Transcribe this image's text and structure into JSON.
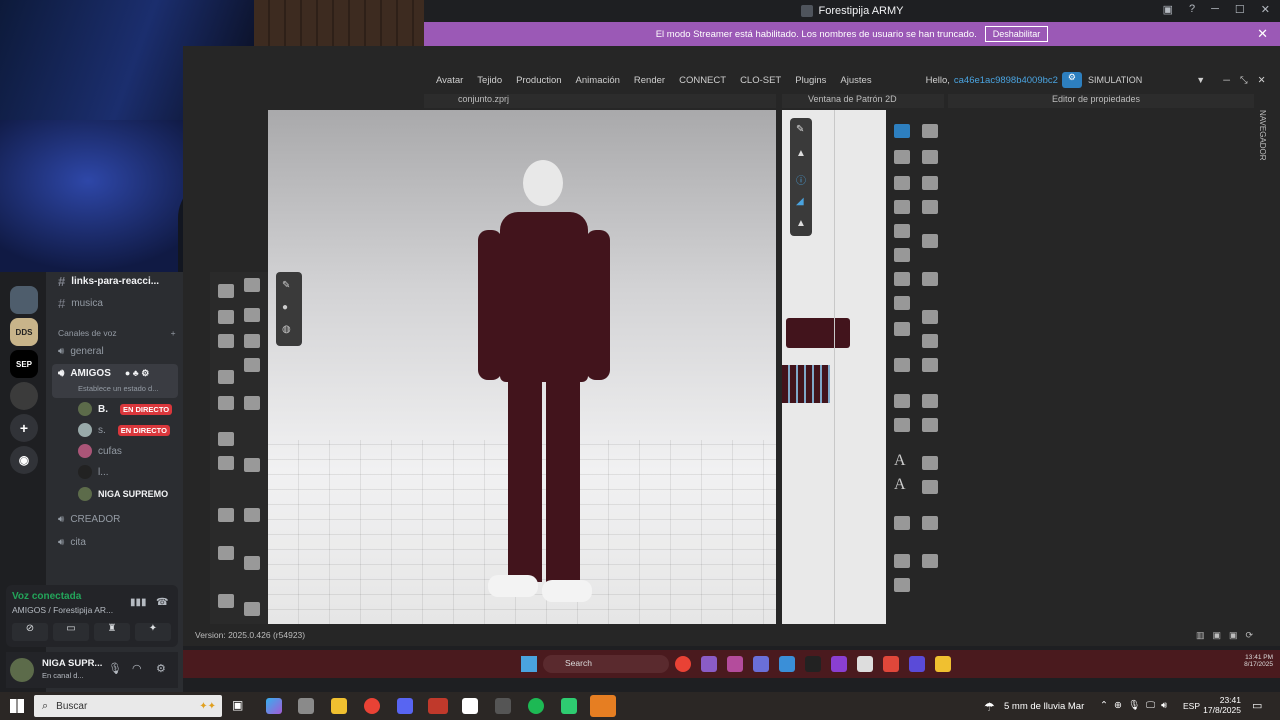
{
  "discord": {
    "title": "Forestipija ARMY",
    "streamer_notice": "El modo Streamer está habilitado. Los nombres de usuario se han truncado.",
    "streamer_disable": "Deshabilitar",
    "servers": [
      "SEP",
      "DDS"
    ],
    "channels": {
      "text": [
        "links-para-reacci...",
        "musica"
      ],
      "voice_header": "Canales de voz",
      "voice": [
        {
          "name": "general"
        },
        {
          "name": "AMIGOS",
          "status": "Establece un estado d..."
        },
        {
          "name": "CREADOR"
        },
        {
          "name": "cita"
        }
      ],
      "members": [
        {
          "name": "B.",
          "live": "EN DIRECTO"
        },
        {
          "name": "s.",
          "live": "EN DIRECTO"
        },
        {
          "name": "cufas"
        },
        {
          "name": "l..."
        },
        {
          "name": "NIGA SUPREMO"
        }
      ]
    },
    "voice_connected": "Voz conectada",
    "voice_channel": "AMIGOS / Forestipija AR...",
    "user": {
      "name": "NIGA SUPR...",
      "status": "En canal d..."
    }
  },
  "clo": {
    "menu": [
      "Avatar",
      "Tejido",
      "Production",
      "Animación",
      "Render",
      "CONNECT",
      "CLO-SET",
      "Plugins",
      "Ajustes"
    ],
    "hello": "Hello,",
    "user_id": "ca46e1ac9898b4009bc2",
    "mode": "SIMULATION",
    "file": "conjunto.zprj",
    "pattern_window": "Ventana de Patrón 2D",
    "properties": "Editor de propiedades",
    "navigator": "NAVEGADOR",
    "version": "Version: 2025.0.426 (r54923)",
    "inner_clock": {
      "time": "13:41 PM",
      "date": "8/17/2025"
    },
    "inner_search": "Search"
  },
  "taskbar": {
    "search_placeholder": "Buscar",
    "weather": "5 mm de lluvia Mar",
    "lang": "ESP",
    "time": "23:41",
    "date": "17/8/2025"
  },
  "colors": {
    "discord_bg": "#2b2d31",
    "streamer": "#9b59b6",
    "live": "#da373c",
    "garment": "#42141c"
  }
}
